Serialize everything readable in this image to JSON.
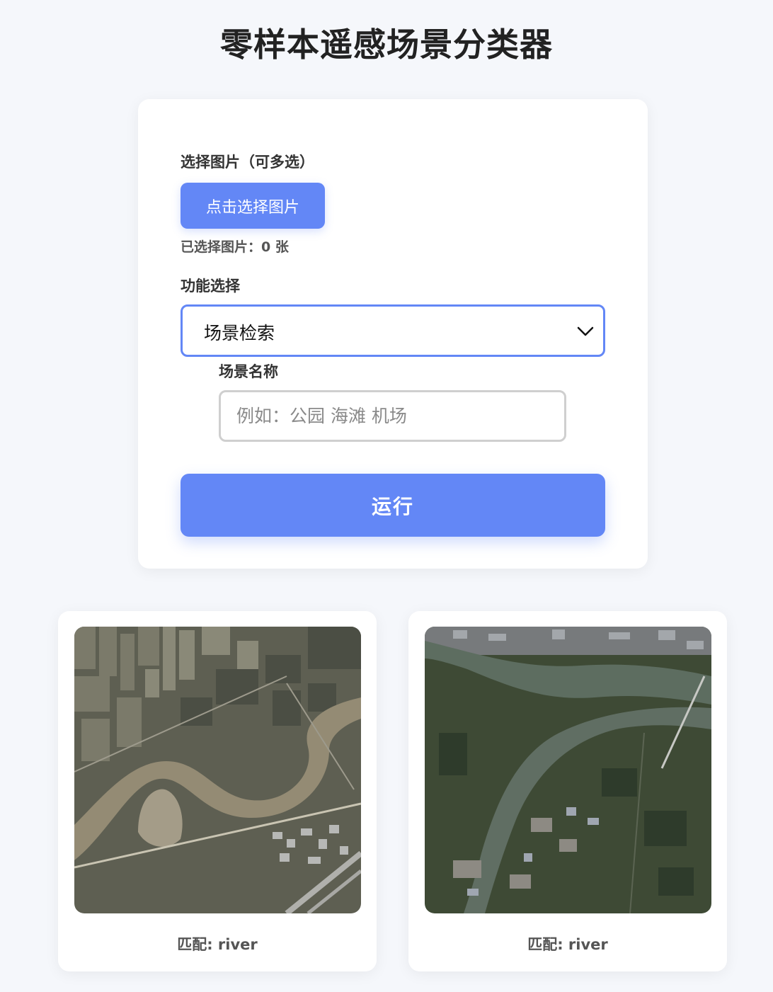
{
  "page": {
    "title": "零样本遥感场景分类器"
  },
  "form": {
    "select_images_label": "选择图片（可多选）",
    "pick_button_label": "点击选择图片",
    "selected_count_text": "已选择图片：0 张",
    "function_label": "功能选择",
    "function_selected": "场景检索",
    "scene_name_label": "场景名称",
    "scene_name_placeholder": "例如：公园 海滩 机场",
    "scene_name_value": "",
    "run_button_label": "运行"
  },
  "results": [
    {
      "caption": "匹配: river"
    },
    {
      "caption": "匹配: river"
    }
  ],
  "colors": {
    "accent": "#6387f6",
    "background": "#f5f7fb"
  }
}
